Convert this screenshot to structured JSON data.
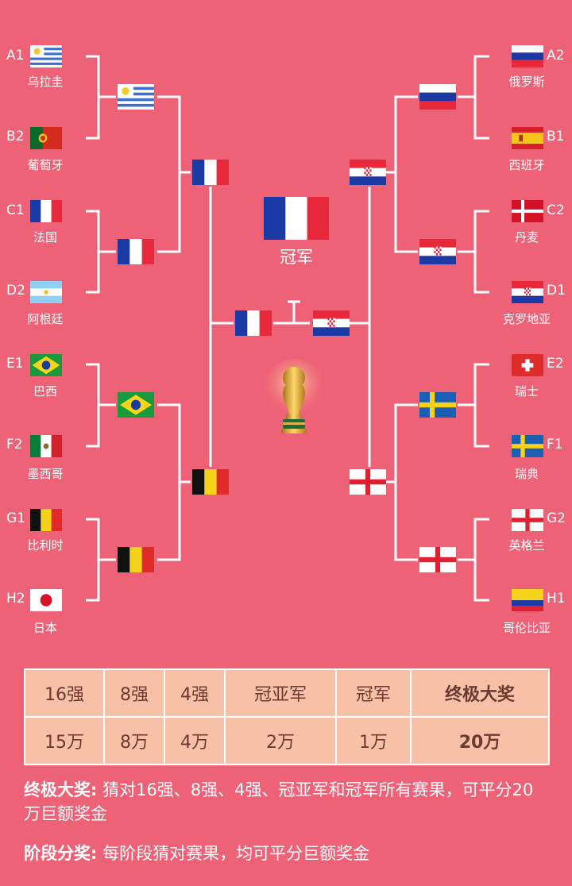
{
  "left_teams": [
    {
      "seed": "A1",
      "name": "乌拉圭",
      "flag": "uruguay-flag"
    },
    {
      "seed": "B2",
      "name": "葡萄牙",
      "flag": "portugal-flag"
    },
    {
      "seed": "C1",
      "name": "法国",
      "flag": "france-flag"
    },
    {
      "seed": "D2",
      "name": "阿根廷",
      "flag": "argentina-flag"
    },
    {
      "seed": "E1",
      "name": "巴西",
      "flag": "brazil-flag"
    },
    {
      "seed": "F2",
      "name": "墨西哥",
      "flag": "mexico-flag"
    },
    {
      "seed": "G1",
      "name": "比利时",
      "flag": "belgium-flag"
    },
    {
      "seed": "H2",
      "name": "日本",
      "flag": "japan-flag"
    }
  ],
  "right_teams": [
    {
      "seed": "A2",
      "name": "俄罗斯",
      "flag": "russia-flag"
    },
    {
      "seed": "B1",
      "name": "西班牙",
      "flag": "spain-flag"
    },
    {
      "seed": "C2",
      "name": "丹麦",
      "flag": "denmark-flag"
    },
    {
      "seed": "D1",
      "name": "克罗地亚",
      "flag": "croatia-flag"
    },
    {
      "seed": "E2",
      "name": "瑞士",
      "flag": "switzerland-flag"
    },
    {
      "seed": "F1",
      "name": "瑞典",
      "flag": "sweden-flag"
    },
    {
      "seed": "G2",
      "name": "英格兰",
      "flag": "england-flag"
    },
    {
      "seed": "H1",
      "name": "哥伦比亚",
      "flag": "colombia-flag"
    }
  ],
  "quarterfinalists_left": [
    "uruguay-flag",
    "france-flag",
    "brazil-flag",
    "belgium-flag"
  ],
  "quarterfinalists_right": [
    "russia-flag",
    "croatia-flag",
    "sweden-flag",
    "england-flag"
  ],
  "semifinalists_left": [
    "france-flag",
    "belgium-flag"
  ],
  "semifinalists_right": [
    "croatia-flag",
    "england-flag"
  ],
  "finalists": [
    "france-flag",
    "croatia-flag"
  ],
  "champion": {
    "label": "冠军",
    "flag": "france-flag"
  },
  "trophy": "world-cup-trophy-icon",
  "prize_table": {
    "headers": [
      "16强",
      "8强",
      "4强",
      "冠亚军",
      "冠军",
      "终极大奖"
    ],
    "amounts": [
      "15万",
      "8万",
      "4万",
      "2万",
      "1万",
      "20万"
    ]
  },
  "notes": {
    "grand_title": "终极大奖:",
    "grand_text": " 猜对16强、8强、4强、冠亚军和冠军所有赛果，可平分20万巨额奖金",
    "stage_title": "阶段分奖:",
    "stage_text": " 每阶段猜对赛果，均可平分巨额奖金"
  },
  "colors": {
    "background": "#ee6277",
    "table_fill": "#f7c1a7",
    "table_text": "#6b3a32"
  }
}
